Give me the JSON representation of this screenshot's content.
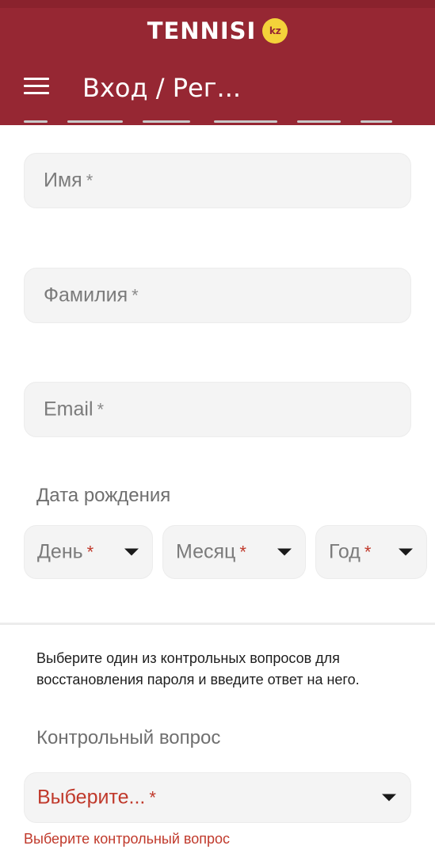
{
  "header": {
    "brand": "TENNISI",
    "badge": "kz",
    "title": "Вход / Рег..."
  },
  "form": {
    "first_name": {
      "label": "Имя",
      "required_mark": "*"
    },
    "last_name": {
      "label": "Фамилия",
      "required_mark": "*"
    },
    "email": {
      "label": "Email",
      "required_mark": "*"
    },
    "birth_date": {
      "label": "Дата рождения",
      "day": {
        "label": "День",
        "required_mark": "*"
      },
      "month": {
        "label": "Месяц",
        "required_mark": "*"
      },
      "year": {
        "label": "Год",
        "required_mark": "*"
      }
    },
    "security": {
      "instruction": "Выберите один из контрольных вопросов для восстановления пароля и введите ответ на него.",
      "label": "Контрольный вопрос",
      "select_value": "Выберите...",
      "required_mark": "*",
      "error": "Выберите контрольный вопрос"
    }
  },
  "colors": {
    "header_bg": "#962733",
    "badge_bg": "#f4d23a",
    "error": "#c0392b",
    "field_bg": "#f4f4f4"
  },
  "icons": {
    "menu": "hamburger-menu-icon",
    "dropdown": "caret-down-icon"
  }
}
